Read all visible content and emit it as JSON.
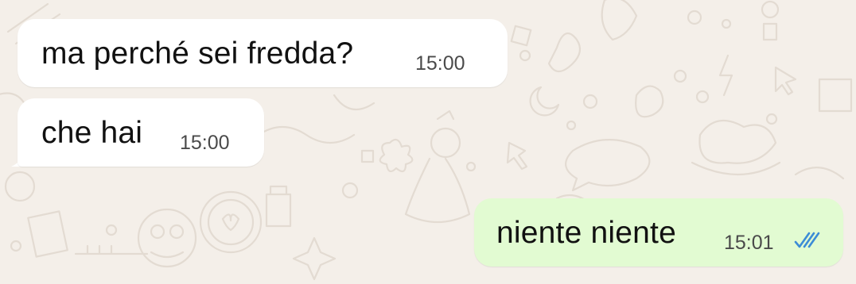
{
  "chat": {
    "messages": [
      {
        "direction": "incoming",
        "text": "ma perché sei fredda?",
        "time": "15:00"
      },
      {
        "direction": "incoming",
        "text": "che hai",
        "time": "15:00"
      },
      {
        "direction": "outgoing",
        "text": "niente niente",
        "time": "15:01",
        "status": "read",
        "status_icon": "double-check-icon"
      }
    ]
  },
  "colors": {
    "wallpaper": "#f4efe9",
    "incoming_bubble": "#ffffff",
    "outgoing_bubble": "#e2fbd2",
    "read_ticks": "#3c8cd6"
  }
}
